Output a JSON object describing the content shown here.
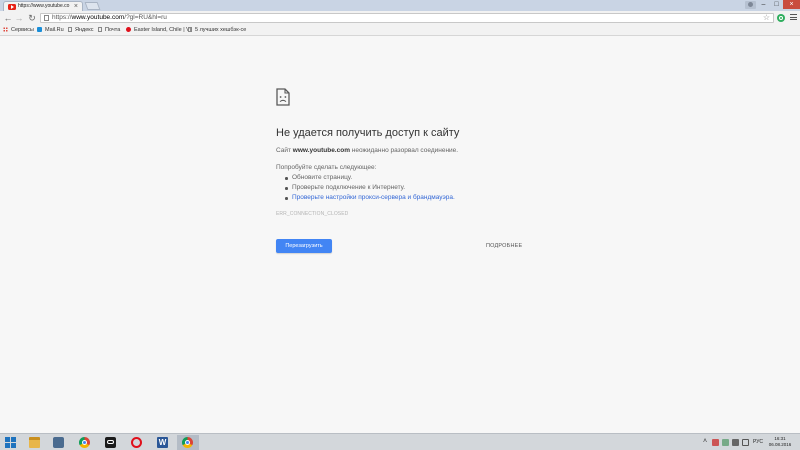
{
  "browser": {
    "tab": {
      "title": "https://www.youtube.co"
    },
    "address_bar": {
      "url_prefix": "https://",
      "url_host": "www.youtube.com",
      "url_rest": "/?gl=RU&hl=ru"
    }
  },
  "bookmarks": [
    {
      "label": "Сервисы",
      "icon": "apps-icon"
    },
    {
      "label": "Mail.Ru",
      "icon": "mailru-icon"
    },
    {
      "label": "Яндекс",
      "icon": "page-icon"
    },
    {
      "label": "Почта",
      "icon": "page-icon"
    },
    {
      "label": "Easter Island, Chile | Vi",
      "icon": "opera-icon"
    },
    {
      "label": "5 лучших хешбэк-се",
      "icon": "page-icon"
    }
  ],
  "error": {
    "title": "Не удается получить доступ к сайту",
    "desc_prefix": "Сайт ",
    "desc_host": "www.youtube.com",
    "desc_suffix": " неожиданно разорвал соединение.",
    "suggestions_heading": "Попробуйте сделать следующее:",
    "suggestions": [
      "Обновите страницу.",
      "Проверьте подключение к Интернету.",
      "Проверьте настройки прокси-сервера и брандмауэра."
    ],
    "code": "ERR_CONNECTION_CLOSED",
    "reload_label": "Перезагрузить",
    "details_label": "ПОДРОБНЕЕ"
  },
  "taskbar": {
    "language": "РУС",
    "time": "16:31",
    "date": "06.08.2016"
  },
  "colors": {
    "accent": "#4285f4",
    "link": "#3367d6",
    "page_bg": "#f7f7f7"
  }
}
